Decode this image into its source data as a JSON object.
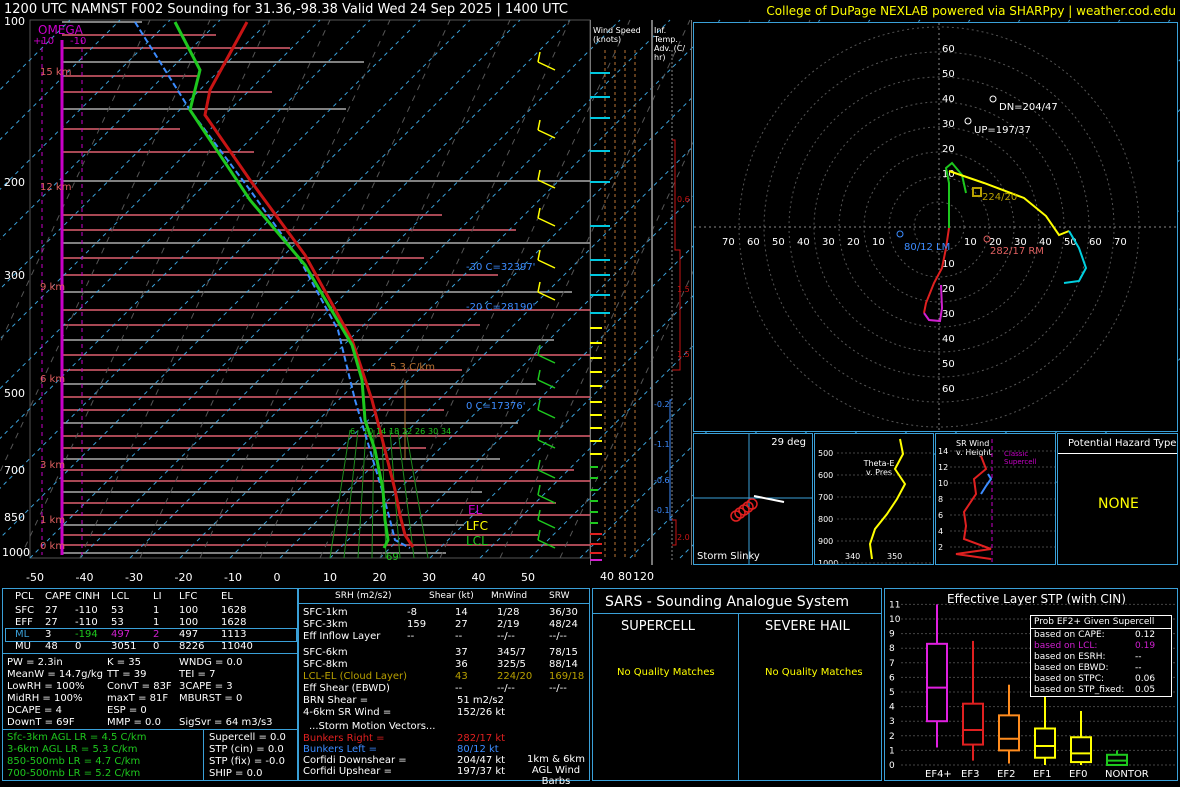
{
  "header": {
    "title": "1200 UTC NAMNST F002 Sounding for 31.36,-98.38 Valid  Wed 24 Sep 2025 | 1400 UTC",
    "credit": "College of DuPage NEXLAB powered via SHARPpy | weather.cod.edu"
  },
  "colors": {
    "temp": "#c81414",
    "dew": "#1ec81e",
    "wetbulb": "#3c8cff",
    "accent": "#3aa0d8",
    "yellow": "#ffff00"
  },
  "skewt": {
    "omega_label": "OMEGA",
    "omega_ticks": [
      "+10",
      "-10"
    ],
    "pressure_labels": [
      "100",
      "200",
      "300",
      "500",
      "700",
      "850",
      "1000"
    ],
    "temp_labels": [
      "-50",
      "-40",
      "-30",
      "-20",
      "-10",
      "0",
      "10",
      "20",
      "30",
      "40",
      "50"
    ],
    "height_labels": [
      "15 km",
      "12 km",
      "9 km",
      "6 km",
      "3 km",
      "1 km",
      "0 km"
    ],
    "isotherm_labels": [
      "-30 C=32397'",
      "-20 C=28190'",
      "0 C=17376'"
    ],
    "lapse_label": "5.3 C/km",
    "parcel_labels": {
      "el": "EL",
      "lfc": "LFC",
      "lcl": "LCL"
    },
    "sfc_dew": "69",
    "mixing_ratio_labels": [
      "6",
      "10",
      "14",
      "18",
      "22",
      "26",
      "30",
      "34"
    ]
  },
  "side_columns": {
    "wind_speed_title": "Wind Speed (knots)",
    "wind_speed_ticks": [
      "40",
      "80",
      "120"
    ],
    "inf_temp_title": "Inf. Temp. Adv. (C/ hr)",
    "inf_temp_values": [
      "0.6",
      "1.5",
      "1.5",
      "-0.2",
      "-1.1",
      "-0.6",
      "-0.1",
      "2.0"
    ]
  },
  "hodograph": {
    "ring_labels": [
      "60",
      "50",
      "40",
      "30",
      "20",
      "10"
    ],
    "x_labels": [
      "70",
      "60",
      "50",
      "40",
      "30",
      "20",
      "10",
      "10",
      "20",
      "30",
      "40",
      "50",
      "60",
      "70"
    ],
    "lower_labels": [
      "10",
      "20",
      "30",
      "40",
      "50",
      "60"
    ],
    "dn_label": "DN=204/47",
    "up_label": "UP=197/37",
    "mean_label": "224/20",
    "lm_label": "80/12 LM",
    "rm_label": "282/17 RM"
  },
  "slinky": {
    "deg": "29 deg",
    "label": "Storm Slinky"
  },
  "theta": {
    "title": "Theta-E v. Pres",
    "y_ticks": [
      "500",
      "600",
      "700",
      "800",
      "900",
      "1000"
    ],
    "x_ticks": [
      "340",
      "350"
    ]
  },
  "srwind": {
    "title": "SR Wind v. Height",
    "y_ticks": [
      "14",
      "12",
      "10",
      "8",
      "6",
      "4",
      "2"
    ],
    "classic": "Classic Supercell"
  },
  "hazard": {
    "title": "Potential Hazard Type",
    "value": "NONE"
  },
  "thermo": {
    "headers": [
      "PCL",
      "CAPE",
      "CINH",
      "LCL",
      "LI",
      "LFC",
      "EL"
    ],
    "rows": [
      [
        "SFC",
        "27",
        "-110",
        "53",
        "1",
        "100",
        "1628"
      ],
      [
        "EFF",
        "27",
        "-110",
        "53",
        "1",
        "100",
        "1628"
      ],
      [
        "ML",
        "3",
        "-194",
        "497",
        "2",
        "497",
        "1113"
      ],
      [
        "MU",
        "48",
        "0",
        "3051",
        "0",
        "8226",
        "11040"
      ]
    ],
    "indices": [
      [
        "PW = 2.3in",
        "K = 35",
        "WNDG = 0.0"
      ],
      [
        "MeanW = 14.7g/kg",
        "TT = 39",
        "TEI = 7"
      ],
      [
        "LowRH = 100%",
        "ConvT = 83F",
        "3CAPE = 3"
      ],
      [
        "MidRH = 100%",
        "maxT = 81F",
        "MBURST = 0"
      ],
      [
        "DCAPE = 4",
        "ESP = 0",
        ""
      ],
      [
        "DownT = 69F",
        "MMP = 0.0",
        "SigSvr = 64 m3/s3"
      ]
    ],
    "lapse": [
      "Sfc-3km AGL LR = 4.5 C/km",
      "3-6km AGL LR = 5.3 C/km",
      "850-500mb LR = 4.7 C/km",
      "700-500mb LR = 5.2 C/km"
    ],
    "params": [
      "Supercell = 0.0",
      "STP (cin) = 0.0",
      "STP (fix) = -0.0",
      "SHIP = 0.0"
    ]
  },
  "kinematic": {
    "headers": [
      "SRH (m2/s2)",
      "Shear (kt)",
      "MnWind",
      "SRW"
    ],
    "rows": [
      [
        "SFC-1km",
        "-8",
        "14",
        "1/28",
        "36/30"
      ],
      [
        "SFC-3km",
        "159",
        "27",
        "2/19",
        "48/24"
      ],
      [
        "Eff Inflow Layer",
        "--",
        "--",
        "--/--",
        "--/--"
      ],
      [
        "SFC-6km",
        "",
        "37",
        "345/7",
        "78/15"
      ],
      [
        "SFC-8km",
        "",
        "36",
        "325/5",
        "88/14"
      ],
      [
        "LCL-EL (Cloud Layer)",
        "",
        "43",
        "224/20",
        "169/18"
      ],
      [
        "Eff Shear (EBWD)",
        "",
        "--",
        "--/--",
        "--/--"
      ]
    ],
    "brn": [
      "BRN Shear =",
      "51 m2/s2"
    ],
    "srwind46": [
      "4-6km SR Wind =",
      "152/26 kt"
    ],
    "storm_title": "...Storm Motion Vectors...",
    "storm": [
      [
        "Bunkers Right =",
        "282/17 kt"
      ],
      [
        "Bunkers Left =",
        "80/12 kt"
      ],
      [
        "Corfidi Downshear =",
        "204/47 kt"
      ],
      [
        "Corfidi Upshear =",
        "197/37 kt"
      ]
    ],
    "barbs_label": "1km & 6km AGL Wind Barbs"
  },
  "sars": {
    "title": "SARS - Sounding Analogue System",
    "supercell": "SUPERCELL",
    "hail": "SEVERE HAIL",
    "sc_none": "No Quality Matches",
    "hail_none": "No Quality Matches"
  },
  "stp": {
    "title": "Effective Layer STP (with CIN)",
    "y_ticks": [
      "11",
      "10",
      "9",
      "8",
      "7",
      "6",
      "5",
      "4",
      "3",
      "2",
      "1",
      "0"
    ],
    "categories": [
      "EF4+",
      "EF3",
      "EF2",
      "EF1",
      "EF0",
      "NONTOR"
    ],
    "box_title": "Prob EF2+ Given Supercell",
    "probs": [
      [
        "based on CAPE:",
        "0.12"
      ],
      [
        "based on LCL:",
        "0.19"
      ],
      [
        "based on ESRH:",
        "--"
      ],
      [
        "based on EBWD:",
        "--"
      ],
      [
        "based on STPC:",
        "0.06"
      ],
      [
        "based on STP_fixed:",
        "0.05"
      ]
    ]
  }
}
